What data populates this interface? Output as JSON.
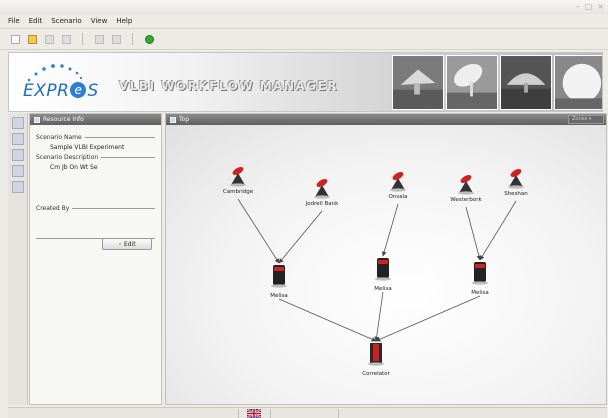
{
  "menu": {
    "items": [
      "File",
      "Edit",
      "Scenario",
      "View",
      "Help"
    ]
  },
  "banner": {
    "logo_pre": "EXPR",
    "logo_ball": "e",
    "logo_post": "S",
    "title": "VLBI WORKFLOW MANAGER"
  },
  "resource_panel": {
    "title": "Resource Info",
    "scenario_name_label": "Scenario Name",
    "scenario_name": "Sample VLBI Experiment",
    "scenario_desc_label": "Scenario Description",
    "scenario_desc": "Cm Jb On Wt Se",
    "created_by_label": "Created By",
    "edit_label": "Edit"
  },
  "top_panel": {
    "title": "Top",
    "dropdown": "Zones"
  },
  "graph": {
    "nodes": [
      {
        "id": "cambridge",
        "label": "Cambridge",
        "kind": "telescope",
        "color": "#cc2222"
      },
      {
        "id": "jodrell",
        "label": "Jodrell Bank",
        "kind": "telescope",
        "color": "#cc2222"
      },
      {
        "id": "onsala",
        "label": "Onsala",
        "kind": "telescope",
        "color": "#cc2222"
      },
      {
        "id": "westerbork",
        "label": "Westerbork",
        "kind": "telescope",
        "color": "#cc2222"
      },
      {
        "id": "sheshan",
        "label": "Sheshan",
        "kind": "telescope",
        "color": "#cc2222"
      },
      {
        "id": "melisa1",
        "label": "Melisa",
        "kind": "server",
        "color": "#cc2222"
      },
      {
        "id": "melisa2",
        "label": "Melisa",
        "kind": "server",
        "color": "#cc2222"
      },
      {
        "id": "melisa3",
        "label": "Melisa",
        "kind": "server",
        "color": "#cc2222"
      },
      {
        "id": "correlator",
        "label": "Correlator",
        "kind": "correlator",
        "color": "#cc2222"
      }
    ],
    "edges": [
      [
        "cambridge",
        "melisa1"
      ],
      [
        "jodrell",
        "melisa1"
      ],
      [
        "onsala",
        "melisa2"
      ],
      [
        "westerbork",
        "melisa3"
      ],
      [
        "sheshan",
        "melisa3"
      ],
      [
        "melisa1",
        "correlator"
      ],
      [
        "melisa2",
        "correlator"
      ],
      [
        "melisa3",
        "correlator"
      ]
    ]
  }
}
